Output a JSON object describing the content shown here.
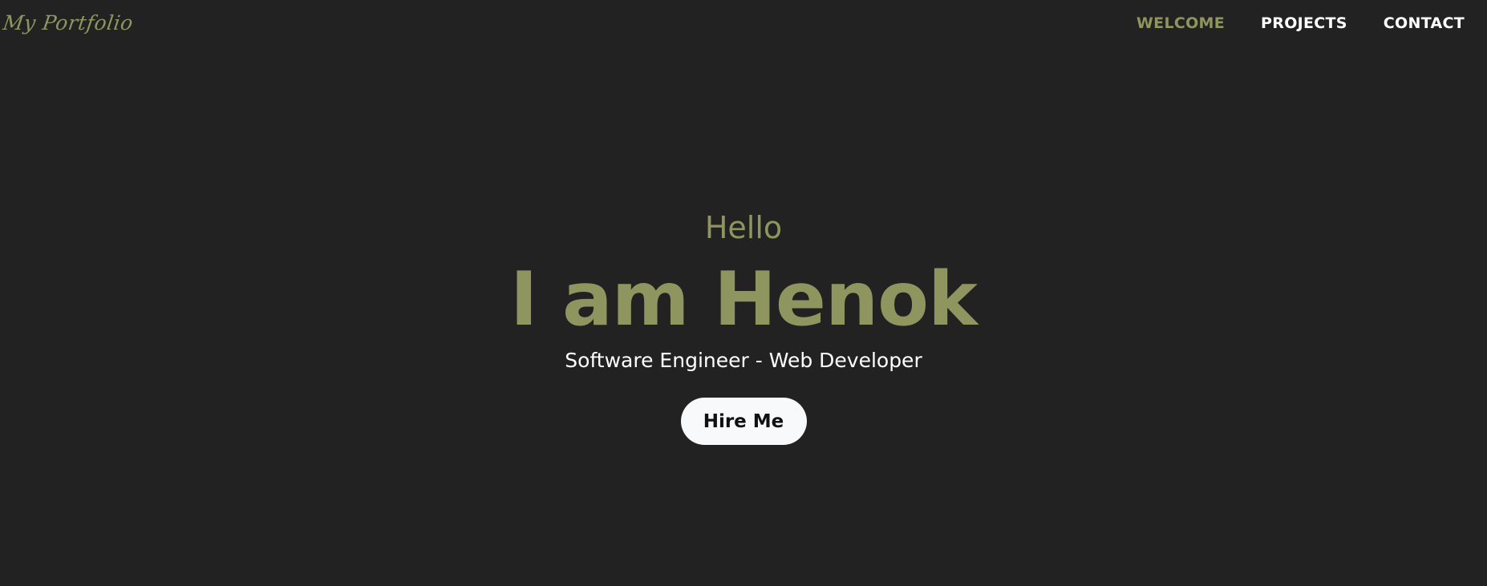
{
  "header": {
    "logo_text": "My Portfolio",
    "nav": [
      {
        "label": "WELCOME",
        "active": true
      },
      {
        "label": "PROJECTS",
        "active": false
      },
      {
        "label": "CONTACT",
        "active": false
      }
    ]
  },
  "hero": {
    "greeting": "Hello",
    "headline": "I am Henok",
    "subtitle": "Software Engineer - Web Developer",
    "cta_label": "Hire Me"
  },
  "colors": {
    "background": "#222222",
    "accent": "#8f955e",
    "text": "#ffffff",
    "button_bg": "#f8f9fa"
  }
}
